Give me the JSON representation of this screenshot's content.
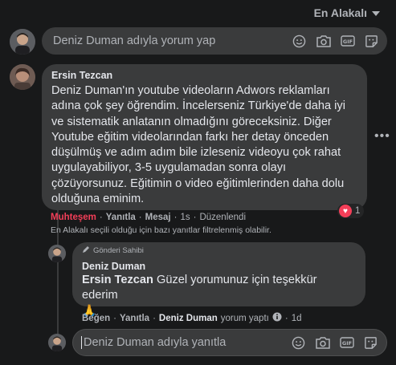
{
  "sort": {
    "label": "En Alakalı"
  },
  "composer": {
    "placeholder": "Deniz Duman adıyla yorum yap"
  },
  "comment": {
    "author": "Ersin Tezcan",
    "lines": [
      "Deniz Duman'ın youtube videoların Adwors reklamları",
      "adına çok şey öğrendim. İncelerseniz Türkiye'de daha iyi",
      "ve sistematik anlatanın olmadığını göreceksiniz. Diğer",
      "Youtube eğitim videolarından farkı her detay önceden",
      "düşülmüş ve adım adım bile izleseniz videoyu çok rahat",
      "uygulayabiliyor, 3-5 uygulamadan sonra olayı",
      "çözüyorsunuz. Eğitimin o video eğitimlerinden daha dolu",
      "olduğuna eminim."
    ],
    "reaction_count": "1",
    "actions": {
      "reaction": "Muhteşem",
      "reply": "Yanıtla",
      "message": "Mesaj",
      "time": "1s",
      "edited": "Düzenlendi"
    },
    "filter_notice": "En Alakalı seçili olduğu için bazı yanıtlar filtrelenmiş olabilir."
  },
  "reply": {
    "badge": "Gönderi Sahibi",
    "author": "Deniz Duman",
    "mention": "Ersin Tezcan",
    "text": "Güzel yorumunuz için teşekkür ederim",
    "emoji": "🙏",
    "actions": {
      "like": "Beğen",
      "reply": "Yanıtla",
      "author": "Deniz Duman",
      "posted": "yorum yaptı",
      "time": "1d"
    }
  },
  "reply_composer": {
    "placeholder": "Deniz Duman adıyla yanıtla"
  }
}
